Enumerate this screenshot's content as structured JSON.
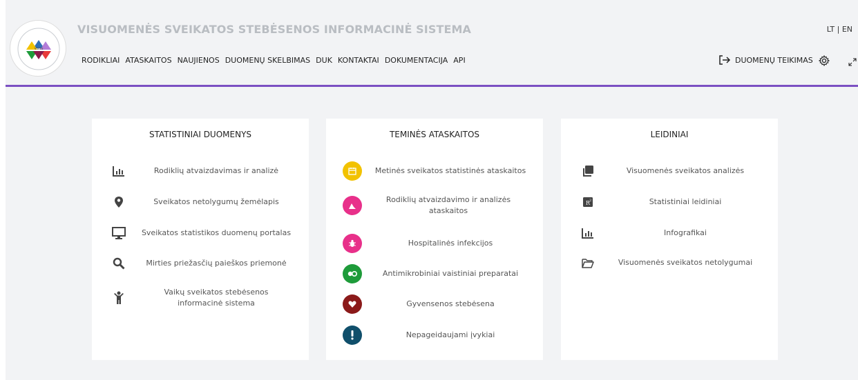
{
  "header": {
    "site_title": "VISUOMENĖS SVEIKATOS STEBĖSENOS INFORMACINĖ SISTEMA",
    "logo_icon": "vsss-logo-icon",
    "lang": {
      "lt": "LT",
      "separator": " | ",
      "en": "EN"
    },
    "nav": [
      "RODIKLIAI",
      "ATASKAITOS",
      "NAUJIENOS",
      "DUOMENŲ SKELBIMAS",
      "DUK",
      "KONTAKTAI",
      "DOKUMENTACIJA",
      "API"
    ],
    "submit_label": "DUOMENŲ TEIKIMAS",
    "accent_color": "#7b4fc2"
  },
  "cards": {
    "stat": {
      "title": "STATISTINIAI DUOMENYS",
      "items": [
        {
          "label": "Rodiklių atvaizdavimas ir analizė",
          "icon": "bar-chart-icon"
        },
        {
          "label": "Sveikatos netolygumų žemėlapis",
          "icon": "map-pin-icon"
        },
        {
          "label": "Sveikatos statistikos duomenų portalas",
          "icon": "monitor-icon"
        },
        {
          "label": "Mirties priežasčių paieškos priemonė",
          "icon": "search-icon"
        },
        {
          "label": "Vaikų sveikatos stebėsenos informacinė sistema",
          "icon": "child-icon"
        }
      ]
    },
    "reports": {
      "title": "TEMINĖS ATASKAITOS",
      "items": [
        {
          "label": "Metinės sveikatos statistinės ataskaitos",
          "icon": "calendar-icon",
          "color": "#f2c200"
        },
        {
          "label": "Rodiklių atvaizdavimo ir analizės ataskaitos",
          "icon": "chart-icon",
          "color": "#e8308a"
        },
        {
          "label": "Hospitalinės infekcijos",
          "icon": "bug-icon",
          "color": "#e8308a"
        },
        {
          "label": "Antimikrobiniai vaistiniai preparatai",
          "icon": "pills-icon",
          "color": "#1e9b3a"
        },
        {
          "label": "Gyvensenos stebėsena",
          "icon": "heart-icon",
          "color": "#8b1a1a"
        },
        {
          "label": "Nepageidaujami įvykiai",
          "icon": "exclamation-icon",
          "color": "#104f6b"
        }
      ]
    },
    "pubs": {
      "title": "LEIDINIAI",
      "items": [
        {
          "label": "Visuomenės sveikatos analizės",
          "icon": "copy-icon"
        },
        {
          "label": "Statistiniai leidiniai",
          "icon": "r-squared-icon"
        },
        {
          "label": "Infografikai",
          "icon": "bar-chart-icon"
        },
        {
          "label": "Visuomenės sveikatos netolygumai",
          "icon": "folder-icon"
        }
      ]
    }
  }
}
